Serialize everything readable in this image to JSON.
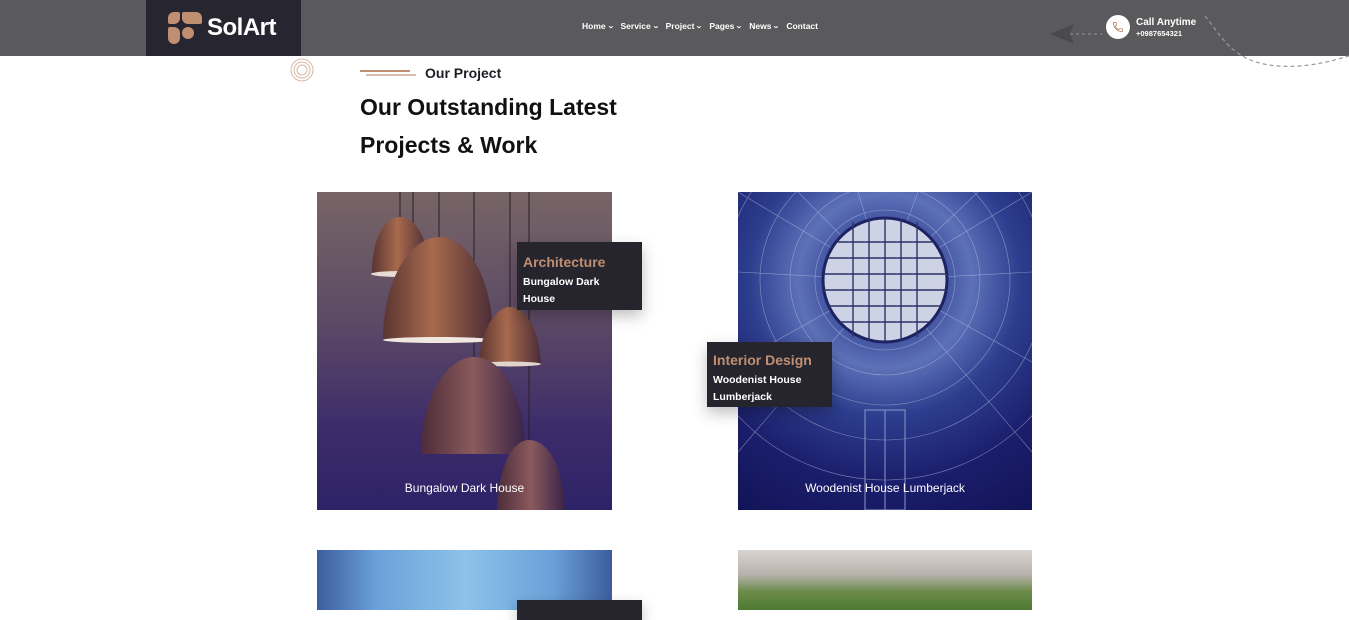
{
  "header": {
    "logo_text": "SolArt",
    "nav": [
      {
        "label": "Home",
        "has_dropdown": true
      },
      {
        "label": "Service",
        "has_dropdown": true
      },
      {
        "label": "Project",
        "has_dropdown": true
      },
      {
        "label": "Pages",
        "has_dropdown": true
      },
      {
        "label": "News",
        "has_dropdown": true
      },
      {
        "label": "Contact",
        "has_dropdown": false
      }
    ],
    "call": {
      "icon": "phone-icon",
      "title": "Call Anytime",
      "number": "+0987654321"
    }
  },
  "section": {
    "tag": "Our Project",
    "title_line1": "Our Outstanding Latest",
    "title_line2": "Projects & Work"
  },
  "projects": [
    {
      "caption": "Bungalow Dark House",
      "category": "Architecture",
      "title": "Bungalow Dark House"
    },
    {
      "caption": "Woodenist House Lumberjack",
      "category": "Interior Design",
      "title": "Woodenist House Lumberjack"
    }
  ],
  "colors": {
    "accent": "#c08f72",
    "header_bg": "#5a595b",
    "dark": "#26252e"
  }
}
